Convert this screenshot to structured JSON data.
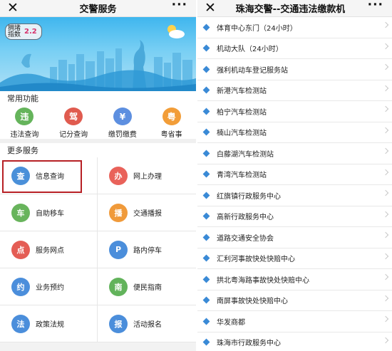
{
  "left": {
    "title": "交警服务",
    "congestion": {
      "label": "拥堵指数",
      "value": "2.2"
    },
    "common_title": "常用功能",
    "common": [
      {
        "icon": "violation-query-icon",
        "glyph": "违",
        "label": "违法查询",
        "color": "#65b45b"
      },
      {
        "icon": "points-query-icon",
        "glyph": "驾",
        "label": "记分查询",
        "color": "#e05b4f"
      },
      {
        "icon": "fine-payment-icon",
        "glyph": "¥",
        "label": "缴罚缴费",
        "color": "#5d8fe0"
      },
      {
        "icon": "yue-sheng-shi-icon",
        "glyph": "粤",
        "label": "粤省事",
        "color": "#f29d38"
      }
    ],
    "more_title": "更多服务",
    "services": [
      {
        "icon": "info-query-icon",
        "glyph": "查",
        "label": "信息查询",
        "color": "#4a90d9"
      },
      {
        "icon": "online-handle-icon",
        "glyph": "办",
        "label": "网上办理",
        "color": "#e9625a"
      },
      {
        "icon": "self-move-car-icon",
        "glyph": "车",
        "label": "自助移车",
        "color": "#68b45c"
      },
      {
        "icon": "traffic-broadcast-icon",
        "glyph": "播",
        "label": "交通播报",
        "color": "#f09a3a"
      },
      {
        "icon": "service-outlet-icon",
        "glyph": "点",
        "label": "服务网点",
        "color": "#e45d55"
      },
      {
        "icon": "road-parking-icon",
        "glyph": "P",
        "label": "路内停车",
        "color": "#4b8edb"
      },
      {
        "icon": "appointment-icon",
        "glyph": "约",
        "label": "业务预约",
        "color": "#4b8edb"
      },
      {
        "icon": "guide-compass-icon",
        "glyph": "南",
        "label": "便民指南",
        "color": "#62b35b"
      },
      {
        "icon": "policy-gavel-icon",
        "glyph": "法",
        "label": "政策法规",
        "color": "#4b8edb"
      },
      {
        "icon": "event-signup-icon",
        "glyph": "报",
        "label": "活动报名",
        "color": "#4b8edb"
      }
    ]
  },
  "right": {
    "title": "珠海交警--交通违法缴款机",
    "items": [
      "体育中心东门（24小时）",
      "机动大队（24小时）",
      "强利机动车登记服务站",
      "新港汽车检测站",
      "柏宁汽车检测站",
      "楠山汽车检测站",
      "白藤湖汽车检测站",
      "青湾汽车检测站",
      "红旗镇行政服务中心",
      "高新行政服务中心",
      "道路交通安全协会",
      "汇利河事故快处快赔中心",
      "拱北粤海路事故快处快赔中心",
      "南屏事故快处快赔中心",
      "华发商都",
      "珠海市行政服务中心"
    ]
  },
  "close_glyph": "✕",
  "more_glyph": "···"
}
